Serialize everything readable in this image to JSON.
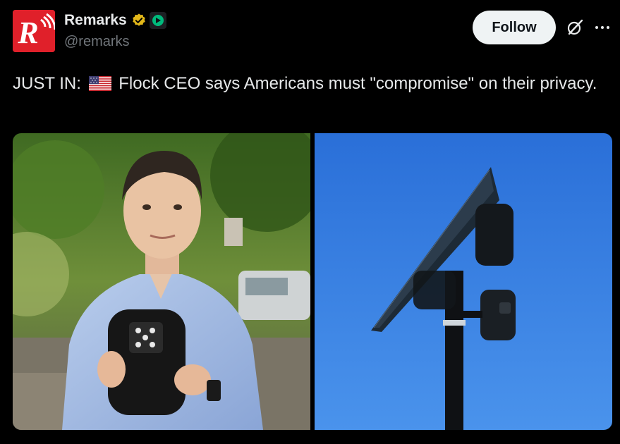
{
  "author": {
    "display_name": "Remarks",
    "handle": "@remarks",
    "avatar_icon": "remarks-logo-icon",
    "avatar_letter": "R",
    "brand_color": "#e0202a",
    "verified_icon": "gold-verified-badge-icon",
    "affiliate_icon": "green-affiliate-badge-icon"
  },
  "actions": {
    "follow_label": "Follow",
    "grok_icon": "grok-icon",
    "more_icon": "more-dots-icon"
  },
  "tweet": {
    "prefix": "JUST IN:",
    "flag_icon": "us-flag-icon",
    "body": "Flock CEO says Americans must \"compromise\" on their privacy."
  },
  "media": [
    {
      "icon": "photo-person-holding-camera",
      "kind": "photo"
    },
    {
      "icon": "photo-solar-camera-pole",
      "kind": "photo"
    }
  ],
  "colors": {
    "background": "#000000",
    "text_primary": "#e7e9ea",
    "text_secondary": "#71767b",
    "follow_bg": "#eff3f4",
    "verified_gold": "#e2b719",
    "affiliate_green": "#00ba7c"
  }
}
